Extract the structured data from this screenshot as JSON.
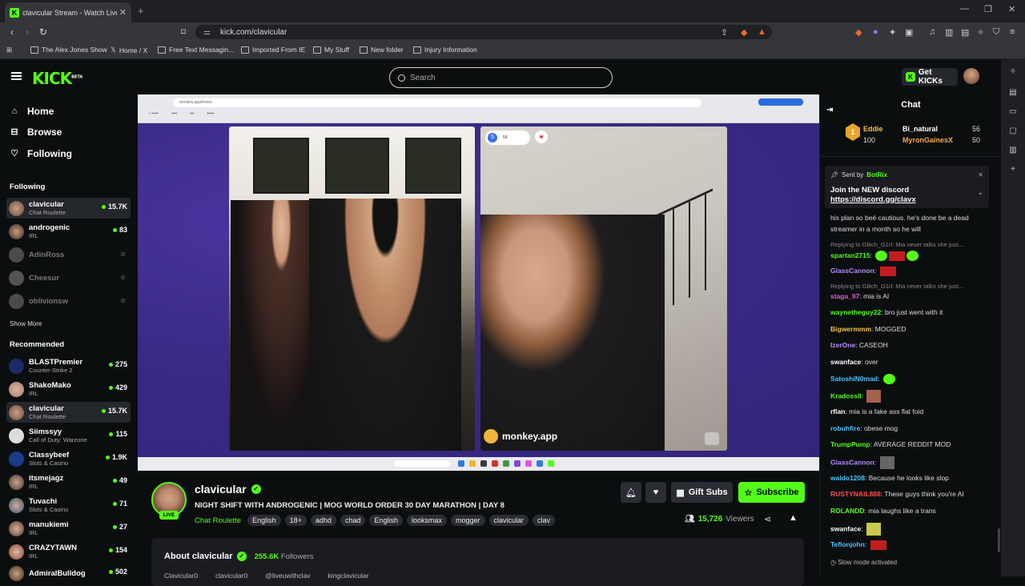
{
  "browser": {
    "tab_title": "clavicular Stream - Watch Live",
    "url": "kick.com/clavicular",
    "bookmarks": [
      "The Alex Jones Show",
      "Home / X",
      "Free Text Messagin...",
      "Imported From IE",
      "My Stuff",
      "New folder",
      "Injury Information"
    ]
  },
  "topbar": {
    "logo": "KICK",
    "logo_badge": "BETA",
    "search_placeholder": "Search",
    "get_kicks": "Get KICKs"
  },
  "sidebar": {
    "nav": [
      {
        "label": "Home",
        "icon": "home-icon"
      },
      {
        "label": "Browse",
        "icon": "browse-icon"
      },
      {
        "label": "Following",
        "icon": "heart-icon"
      }
    ],
    "following_title": "Following",
    "following": [
      {
        "name": "clavicular",
        "category": "Chat Roulette",
        "viewers": "15.7K",
        "live": true,
        "active": true
      },
      {
        "name": "androgenic",
        "category": "IRL",
        "viewers": "83",
        "live": true
      },
      {
        "name": "AdinRoss",
        "category": "",
        "viewers": "",
        "live": false
      },
      {
        "name": "Cheesur",
        "category": "",
        "viewers": "",
        "live": false
      },
      {
        "name": "oblivionsw",
        "category": "",
        "viewers": "",
        "live": false
      }
    ],
    "show_more": "Show More",
    "recommended_title": "Recommended",
    "recommended": [
      {
        "name": "BLASTPremier",
        "category": "Counter-Strike 2",
        "viewers": "275"
      },
      {
        "name": "ShakoMako",
        "category": "IRL",
        "viewers": "429"
      },
      {
        "name": "clavicular",
        "category": "Chat Roulette",
        "viewers": "15.7K",
        "active": true
      },
      {
        "name": "Siimssyy",
        "category": "Call of Duty: Warzone",
        "viewers": "115"
      },
      {
        "name": "Classybeef",
        "category": "Slots & Casino",
        "viewers": "1.9K"
      },
      {
        "name": "itsmejagz",
        "category": "IRL",
        "viewers": "49"
      },
      {
        "name": "Tuvachi",
        "category": "Slots & Casino",
        "viewers": "71"
      },
      {
        "name": "manukiemi",
        "category": "IRL",
        "viewers": "27"
      },
      {
        "name": "CRAZYTAWN",
        "category": "IRL",
        "viewers": "154"
      },
      {
        "name": "AdmiralBulldog",
        "category": "",
        "viewers": "502"
      }
    ]
  },
  "video": {
    "inner_url": "monkey.app/home",
    "watermark": "monkey.app",
    "badge_count": "59"
  },
  "stream": {
    "channel": "clavicular",
    "live_label": "LIVE",
    "title": "NIGHT SHIFT WITH ANDROGENIC | MOG WORLD ORDER 30 DAY MARATHON | DAY 8",
    "category": "Chat Roulette",
    "tags": [
      "English",
      "18+",
      "adhd",
      "chad",
      "English",
      "looksmax",
      "mogger",
      "clavicular",
      "clav"
    ],
    "gift_subs": "Gift Subs",
    "subscribe": "Subscribe",
    "viewers": "15,726",
    "viewers_label": "Viewers",
    "about_label": "About clavicular",
    "followers": "255.6K",
    "followers_label": "Followers",
    "socials": [
      "Clavicular0",
      "clavicular0",
      "@liveuwithclav",
      "kingclavicular"
    ]
  },
  "chat": {
    "title": "Chat",
    "gifters": [
      {
        "name": "Eddie",
        "amount": "100"
      },
      {
        "name": "Bi_natural",
        "amount": "56"
      },
      {
        "name": "MyronGainesX",
        "amount": "50"
      }
    ],
    "pinned": {
      "sent_by": "Sent by",
      "author": "BotRix",
      "line1": "Join the NEW discord",
      "link": "https://discord.gg/clavx"
    },
    "messages": [
      {
        "user": "",
        "text": "his plan so beé cautious. he's done be a dead",
        "color": "#ddd"
      },
      {
        "user": "",
        "text": "streamer in a month so he will",
        "color": "#ddd"
      },
      {
        "reply": "Replying to Glitch_G1rl: Mia never talks she just..."
      },
      {
        "user": "spartan2715",
        "text": "",
        "color": "#53fc18",
        "emotes": "green-red-green"
      },
      {
        "user": "GlassCannon",
        "text": "",
        "color": "#b48cff",
        "emotes": "red"
      },
      {
        "reply": "Replying to Glitch_G1rl: Mia never talks she just..."
      },
      {
        "user": "staga_97",
        "text": "mia is AI",
        "color": "#e05ad6"
      },
      {
        "user": "waynetheguy22",
        "text": "bro just went with it",
        "color": "#53fc18"
      },
      {
        "user": "Bigwermmm",
        "text": "MOGGED",
        "color": "#f2c14e"
      },
      {
        "user": "IzerOne",
        "text": "CASEOH",
        "color": "#b48cff"
      },
      {
        "user": "swanface",
        "text": "over",
        "color": "#ffffff"
      },
      {
        "user": "SatoshiN0mad",
        "text": "",
        "color": "#4ec3ff",
        "emotes": "green"
      },
      {
        "user": "Kradossll",
        "text": "",
        "color": "#53fc18",
        "emotes": "pic"
      },
      {
        "user": "rflan",
        "text": "mia is a fake ass flat foid",
        "color": "#ffffff"
      },
      {
        "user": "robuhfire",
        "text": "obese mog",
        "color": "#4ec3ff"
      },
      {
        "user": "TrumpPump",
        "text": "AVERAGE REDDIT MOD",
        "color": "#53fc18"
      },
      {
        "user": "GlassCannon",
        "text": "",
        "color": "#b48cff",
        "emotes": "pic"
      },
      {
        "user": "waldo1208",
        "text": "Because he looks like slop",
        "color": "#4ec3ff"
      },
      {
        "user": "RUSTYNAIL888",
        "text": "These guys think you're AI",
        "color": "#ff4d4d"
      },
      {
        "user": "ROLANDD",
        "text": "mia laughs like a trans",
        "color": "#53fc18"
      },
      {
        "user": "swanface",
        "text": "",
        "color": "#ffffff",
        "emotes": "pic"
      },
      {
        "user": "Teflonjohn",
        "text": "",
        "color": "#4ec3ff",
        "emotes": "red"
      }
    ],
    "slow_mode": "Slow mode activated"
  }
}
